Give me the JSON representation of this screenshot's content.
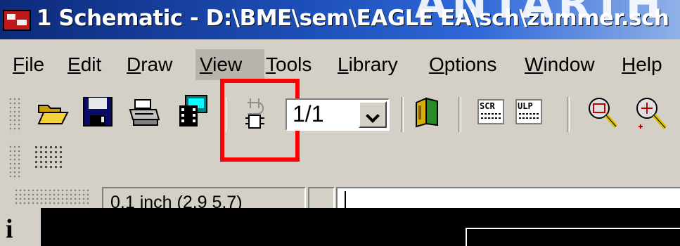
{
  "window": {
    "title": "1 Schematic - D:\\BME\\sem\\EAGLE EA\\sch\\zummer.sch",
    "title_overflow": "ANTARTH"
  },
  "menu": {
    "items": [
      {
        "key": "F",
        "rest": "ile"
      },
      {
        "key": "E",
        "rest": "dit"
      },
      {
        "key": "D",
        "rest": "raw"
      },
      {
        "key": "V",
        "rest": "iew"
      },
      {
        "key": "T",
        "rest": "ools"
      },
      {
        "key": "L",
        "rest": "ibrary"
      },
      {
        "key": "O",
        "rest": "ptions"
      },
      {
        "key": "W",
        "rest": "indow"
      },
      {
        "key": "H",
        "rest": "elp"
      }
    ],
    "active_index": 3
  },
  "toolbar": {
    "icons": [
      "open-folder-icon",
      "save-disk-icon",
      "print-icon",
      "cam-film-icon",
      "add-part-icon",
      "board-switch-icon",
      "script-icon",
      "ulp-icon",
      "zoom-fit-icon",
      "zoom-in-icon"
    ],
    "sheet_value": "1/1",
    "script_label": "SCR",
    "ulp_label": "ULP"
  },
  "status": {
    "grid_text": "0.1 inch (2.9 5.7)",
    "command_value": ""
  },
  "colors": {
    "highlight": "#ff0000",
    "titlebar": "#1d4fb8",
    "canvas": "#000000"
  }
}
